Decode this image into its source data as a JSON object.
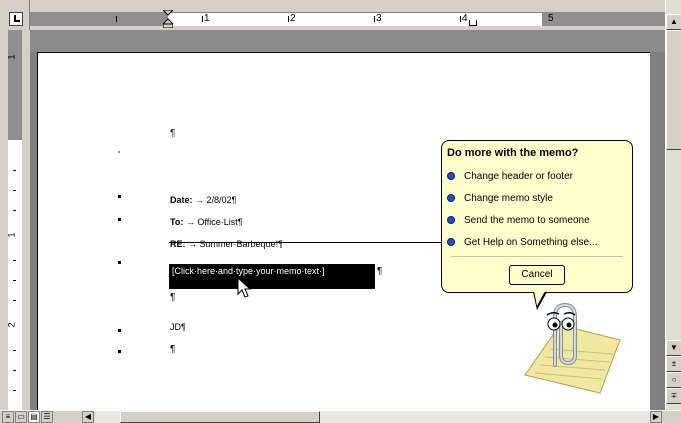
{
  "ruler": {
    "numbers": [
      "1",
      "2",
      "3",
      "4",
      "5"
    ],
    "vnumbers": [
      "1",
      "1",
      "2"
    ]
  },
  "document": {
    "pilcrow": "¶",
    "date_label": "Date:",
    "date_arrow": "→",
    "date_value": "2/8/02¶",
    "to_label": "To:",
    "to_arrow": "→",
    "to_value": "Office·List¶",
    "re_label": "RE:",
    "re_arrow": "→",
    "re_value": "Summer·Barbeque!¶",
    "field_text": "[Click·here·and·type·your·memo·text·]",
    "field_after": "¶",
    "after_field": "¶",
    "initials": "JD¶",
    "last": "¶"
  },
  "assistant": {
    "title": "Do more with the memo?",
    "options": [
      "Change header or footer",
      "Change memo style",
      "Send the memo to someone",
      "Get Help on Something else..."
    ],
    "cancel_label": "Cancel",
    "character": "paperclip-office-assistant"
  },
  "scrollbar": {
    "up": "▲",
    "down": "▼",
    "prev_page": "±",
    "select_browse": "○",
    "next_page": "∓",
    "left": "◀",
    "right": "▶"
  },
  "views": {
    "normal": "≡",
    "web": "▭",
    "print": "▤",
    "outline": "☰"
  },
  "colors": {
    "balloon_bg": "#ffffcc",
    "option_dot": "#2050c0",
    "chrome": "#d4d0c8"
  }
}
